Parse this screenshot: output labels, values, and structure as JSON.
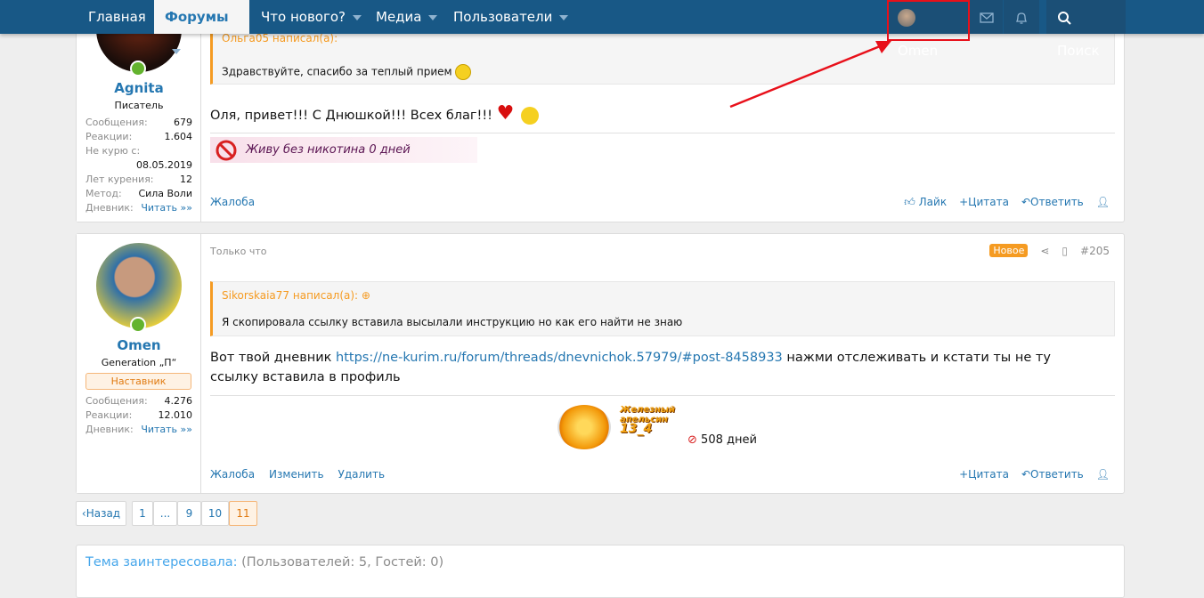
{
  "nav": {
    "items": [
      {
        "label": "Главная"
      },
      {
        "label": "Форумы"
      },
      {
        "label": "Что нового?"
      },
      {
        "label": "Медиа"
      },
      {
        "label": "Пользователи"
      }
    ],
    "user": "Omen",
    "search": "Поиск",
    "icons": [
      "envelope-icon",
      "bell-icon",
      "search-icon"
    ]
  },
  "post1": {
    "user": {
      "name": "Agnita",
      "title": "Писатель",
      "stats": [
        {
          "k": "Сообщения:",
          "v": "679"
        },
        {
          "k": "Реакции:",
          "v": "1.604"
        },
        {
          "k": "Не курю с:",
          "v": ""
        },
        {
          "k": "",
          "v": "08.05.2019"
        },
        {
          "k": "Лет курения:",
          "v": "12"
        },
        {
          "k": "Метод:",
          "v": "Сила Воли"
        },
        {
          "k": "Дневник:",
          "v": "Читать »»"
        }
      ]
    },
    "quote": {
      "author": "Ольга05 написал(а):",
      "text": "Здравствуйте, спасибо за теплый прием"
    },
    "text": "Оля, привет!!! С Днюшкой!!! Всех благ!!!",
    "signature": "Живу без никотина 0 дней",
    "actions": {
      "report": "Жалоба",
      "like": "Лайк",
      "quote": "Цитата",
      "reply": "Ответить"
    }
  },
  "post2": {
    "user": {
      "name": "Omen",
      "title": "Generation „П“",
      "badge": "Наставник",
      "stats": [
        {
          "k": "Сообщения:",
          "v": "4.276"
        },
        {
          "k": "Реакции:",
          "v": "12.010"
        },
        {
          "k": "Дневник:",
          "v": "Читать »»"
        }
      ]
    },
    "time": "Только что",
    "new_badge": "Новое",
    "number": "#205",
    "quote": {
      "author": "Sikorskaia77 написал(а):",
      "text": "Я скопировала ссылку вставила высылали инструкцию но как его найти не знаю"
    },
    "text_before": "Вот твой дневник ",
    "link": "https://ne-kurim.ru/forum/threads/dnevnichok.57979/#post-8458933",
    "text_after": " нажми отслеживать и кстати ты не ту ссылку вставила в профиль",
    "signature_logo": "Железный апельсин 13_4",
    "signature_days": "508 дней",
    "actions": {
      "report": "Жалоба",
      "edit": "Изменить",
      "delete": "Удалить",
      "quote": "Цитата",
      "reply": "Ответить"
    }
  },
  "pagination": {
    "prev": "Назад",
    "pages": [
      "1",
      "...",
      "9",
      "10",
      "11"
    ],
    "current": "11"
  },
  "watchers": {
    "label": "Тема заинтересовала:",
    "count": "(Пользователей: 5, Гостей: 0)"
  },
  "colors": {
    "nav": "#185886",
    "accent": "#2577b1",
    "quote": "#f59b22",
    "annotation": "#e8101a"
  }
}
